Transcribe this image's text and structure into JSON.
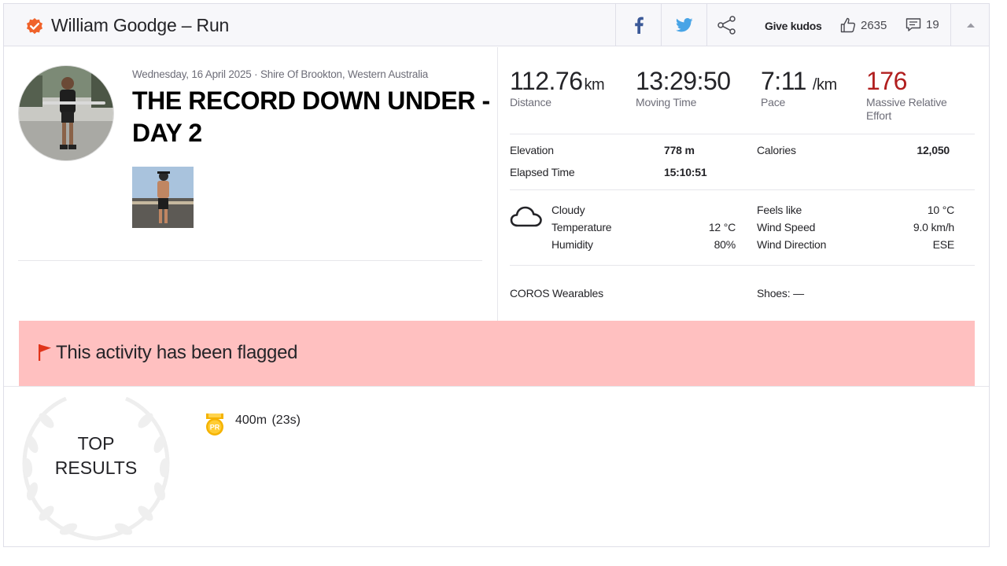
{
  "header": {
    "athlete_name": "William Goodge",
    "separator": "–",
    "activity_type": "Run",
    "give_kudos_label": "Give kudos",
    "kudos_count": "2635",
    "comment_count": "19"
  },
  "activity": {
    "date_location": "Wednesday, 16 April 2025 · Shire Of Brookton, Western Australia",
    "title": "THE RECORD DOWN UNDER - DAY 2"
  },
  "stats": {
    "distance": {
      "value": "112.76",
      "unit": "km",
      "label": "Distance"
    },
    "moving_time": {
      "value": "13:29:50",
      "label": "Moving Time"
    },
    "pace": {
      "value": "7:11",
      "unit": "/km",
      "label": "Pace"
    },
    "effort": {
      "value": "176",
      "label": "Massive Relative Effort"
    }
  },
  "details": {
    "elevation_label": "Elevation",
    "elevation_value": "778 m",
    "calories_label": "Calories",
    "calories_value": "12,050",
    "elapsed_label": "Elapsed Time",
    "elapsed_value": "15:10:51"
  },
  "weather": {
    "condition": "Cloudy",
    "temperature_label": "Temperature",
    "temperature_value": "12 °C",
    "humidity_label": "Humidity",
    "humidity_value": "80%",
    "feels_like_label": "Feels like",
    "feels_like_value": "10 °C",
    "wind_speed_label": "Wind Speed",
    "wind_speed_value": "9.0 km/h",
    "wind_direction_label": "Wind Direction",
    "wind_direction_value": "ESE"
  },
  "gear": {
    "device": "COROS Wearables",
    "shoes": "Shoes: —"
  },
  "flag": {
    "message": "This activity has been flagged"
  },
  "top_results": {
    "heading_line1": "TOP",
    "heading_line2": "RESULTS",
    "items": [
      {
        "badge": "PR",
        "text": "400m (23s)"
      }
    ]
  },
  "colors": {
    "effort_red": "#b11f1f",
    "flag_bg": "#ffc0c0",
    "strava_orange": "#fc4c02",
    "pr_gold": "#f5b301"
  }
}
